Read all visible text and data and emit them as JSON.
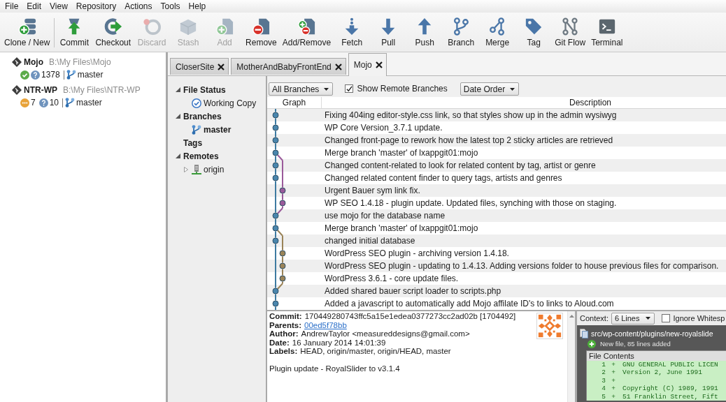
{
  "menu": [
    "File",
    "Edit",
    "View",
    "Repository",
    "Actions",
    "Tools",
    "Help"
  ],
  "toolbar": [
    {
      "label": "Clone / New",
      "disabled": false
    },
    {
      "label": "Commit",
      "disabled": false
    },
    {
      "label": "Checkout",
      "disabled": false
    },
    {
      "label": "Discard",
      "disabled": true
    },
    {
      "label": "Stash",
      "disabled": true
    },
    {
      "label": "Add",
      "disabled": true
    },
    {
      "label": "Remove",
      "disabled": false
    },
    {
      "label": "Add/Remove",
      "disabled": false
    },
    {
      "label": "Fetch",
      "disabled": false
    },
    {
      "label": "Pull",
      "disabled": false
    },
    {
      "label": "Push",
      "disabled": false
    },
    {
      "label": "Branch",
      "disabled": false
    },
    {
      "label": "Merge",
      "disabled": false
    },
    {
      "label": "Tag",
      "disabled": false
    },
    {
      "label": "Git Flow",
      "disabled": false
    },
    {
      "label": "Terminal",
      "disabled": false
    }
  ],
  "repositories": [
    {
      "name": "Mojo",
      "path": "B:\\My Files\\Mojo",
      "badges": [
        {
          "kind": "clean"
        },
        {
          "kind": "question",
          "count": "1378"
        }
      ],
      "branch": "master"
    },
    {
      "name": "NTR-WP",
      "path": "B:\\My Files\\NTR-WP",
      "badges": [
        {
          "kind": "pending",
          "count": "7"
        },
        {
          "kind": "question",
          "count": "10"
        }
      ],
      "branch": "master"
    }
  ],
  "tabs": [
    {
      "label": "CloserSite",
      "selected": false
    },
    {
      "label": "MotherAndBabyFrontEnd",
      "selected": false
    },
    {
      "label": "Mojo",
      "selected": true
    }
  ],
  "sidebar": {
    "items": [
      {
        "label": "File Status",
        "expanded": true,
        "children": [
          {
            "label": "Working Copy",
            "kind": "working-copy"
          }
        ]
      },
      {
        "label": "Branches",
        "expanded": true,
        "children": [
          {
            "label": "master",
            "kind": "branch",
            "current": true
          }
        ]
      },
      {
        "label": "Tags"
      },
      {
        "label": "Remotes",
        "expanded": true,
        "children": [
          {
            "label": "origin",
            "kind": "remote",
            "expanded": false
          }
        ]
      }
    ]
  },
  "log_toolbar": {
    "branch_filter": "All Branches",
    "show_remote": {
      "label": "Show Remote Branches",
      "checked": true
    },
    "order": "Date Order"
  },
  "commits": {
    "columns": [
      "Graph",
      "Description"
    ],
    "rows": [
      {
        "description": "Fixing 404ing editor-style.css link, so that styles show up in the admin wysiwyg",
        "kind": "commit",
        "color": "#4a86ad"
      },
      {
        "description": "WP Core Version_3.7.1 update.",
        "kind": "commit",
        "color": "#4a86ad"
      },
      {
        "description": "Changed front-page to rework how the latest top 2 sticky articles are retrieved",
        "kind": "commit",
        "color": "#4a86ad"
      },
      {
        "description": "Merge branch 'master' of lxappgit01:mojo",
        "kind": "merge",
        "color": "#4a86ad"
      },
      {
        "description": "Changed content-related to look for related content by tag, artist or genre",
        "kind": "commit",
        "color": "#4a86ad"
      },
      {
        "description": "Changed related content finder to query tags, artists and genres",
        "kind": "commit",
        "color": "#4a86ad"
      },
      {
        "description": "Urgent Bauer sym link fix.",
        "kind": "side",
        "color": "#9a5a9a"
      },
      {
        "description": "WP SEO 1.4.18 - plugin update. Updated files, synching with those on staging.",
        "kind": "side",
        "color": "#9a5a9a"
      },
      {
        "description": "use mojo for the database name",
        "kind": "commit",
        "color": "#4a86ad"
      },
      {
        "description": "Merge branch 'master' of lxappgit01:mojo",
        "kind": "merge",
        "color": "#4a86ad"
      },
      {
        "description": "changed initial database",
        "kind": "commit",
        "color": "#4a86ad"
      },
      {
        "description": "WordPress SEO plugin - archiving version 1.4.18.",
        "kind": "side",
        "color": "#9a8358"
      },
      {
        "description": "WordPress SEO plugin - updating to 1.4.13. Adding versions folder to house previous files for comparison.",
        "kind": "side",
        "color": "#9a8358"
      },
      {
        "description": "WordPress 3.6.1 - core update files.",
        "kind": "side",
        "color": "#9a8358"
      },
      {
        "description": "Added shared bauer script loader to scripts.php",
        "kind": "commit",
        "color": "#4a86ad"
      },
      {
        "description": "Added a javascript to automatically add Mojo affilate ID's to links to Aloud.com",
        "kind": "commit",
        "color": "#4a86ad"
      }
    ]
  },
  "details": {
    "fields": [
      {
        "label": "Commit:",
        "value": "170449280743ffc5a15e1edea0377273cc2ad02b [1704492]",
        "kind": "text"
      },
      {
        "label": "Parents:",
        "value": "00ed5f78bb",
        "kind": "link"
      },
      {
        "label": "Author:",
        "value": "AndrewTaylor <measureddesigns@gmail.com>",
        "kind": "text"
      },
      {
        "label": "Date:",
        "value": "16 January 2014 14:01:39",
        "kind": "text"
      },
      {
        "label": "Labels:",
        "value": "HEAD, origin/master, origin/HEAD, master",
        "kind": "text"
      }
    ],
    "message": "Plugin update - RoyalSlider to v3.1.4"
  },
  "diff": {
    "context_label": "Context:",
    "context": "6 Lines",
    "ignore_whitespace": {
      "label": "Ignore Whitesp",
      "checked": false
    },
    "file": {
      "path": "src/wp-content/plugins/new-royalslide",
      "summary": "New file, 85 lines added"
    },
    "contents_title": "File Contents",
    "lines": [
      {
        "number": "1",
        "sign": "+",
        "text": "GNU GENERAL PUBLIC LICEN",
        "kind": "added"
      },
      {
        "number": "2",
        "sign": "+",
        "text": "Version 2, June 1991",
        "kind": "added"
      },
      {
        "number": "3",
        "sign": "+",
        "kind": "added"
      },
      {
        "number": "4",
        "sign": "+",
        "text": "Copyright (C) 1989, 1991",
        "kind": "added"
      },
      {
        "number": "5",
        "sign": "+",
        "text": "51 Franklin Street, Fift",
        "kind": "added"
      }
    ]
  }
}
